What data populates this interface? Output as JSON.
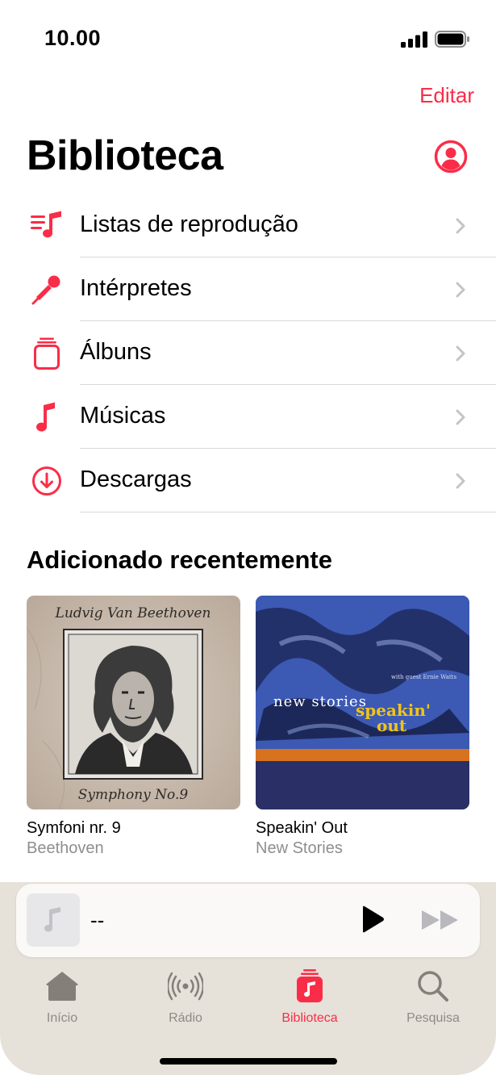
{
  "status_bar": {
    "time": "10.00"
  },
  "header": {
    "edit_label": "Editar",
    "title": "Biblioteca"
  },
  "menu": {
    "items": [
      {
        "label": "Listas de reprodução",
        "icon": "playlist-icon"
      },
      {
        "label": "Intérpretes",
        "icon": "microphone-icon"
      },
      {
        "label": "Álbuns",
        "icon": "album-stack-icon"
      },
      {
        "label": "Músicas",
        "icon": "music-note-icon"
      },
      {
        "label": "Descargas",
        "icon": "download-circle-icon"
      }
    ]
  },
  "recent": {
    "title": "Adicionado recentemente",
    "albums": [
      {
        "title": "Symfoni nr. 9",
        "artist": "Beethoven",
        "cover_top": "Ludvig Van Beethoven",
        "cover_bottom": "Symphony No.9"
      },
      {
        "title": "Speakin' Out",
        "artist": "New Stories",
        "cover_text_1": "new stories",
        "cover_text_2": "speakin'",
        "cover_text_3": "out",
        "cover_small": "with guest Ernie Watts"
      }
    ]
  },
  "mini_player": {
    "title": "--"
  },
  "tabs": [
    {
      "label": "Início",
      "icon": "home-icon"
    },
    {
      "label": "Rádio",
      "icon": "radio-icon"
    },
    {
      "label": "Biblioteca",
      "icon": "library-icon",
      "active": true
    },
    {
      "label": "Pesquisa",
      "icon": "search-icon"
    }
  ],
  "colors": {
    "accent": "#fa2d48",
    "secondary_text": "#8e8e93",
    "player_bg": "#e6e1d9"
  }
}
